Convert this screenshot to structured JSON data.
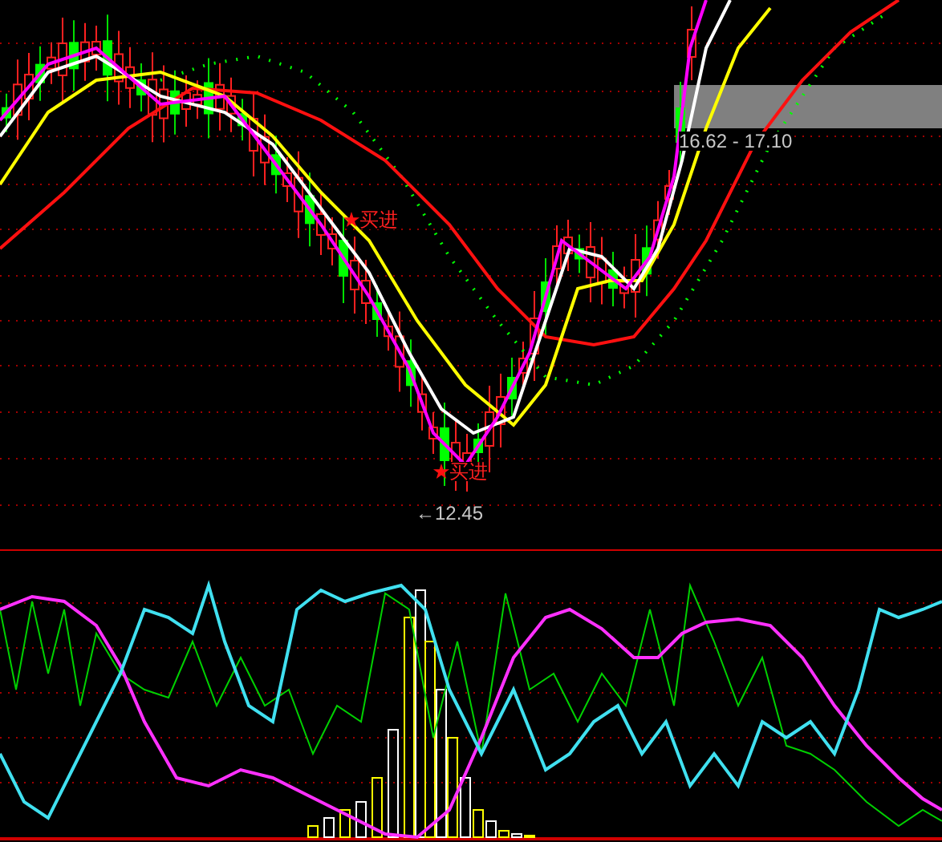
{
  "price_panel": {
    "range_label": "16.62 - 17.10",
    "low_label": "←12.45",
    "signals": [
      {
        "text": "买进"
      },
      {
        "text": "买进"
      }
    ]
  }
}
